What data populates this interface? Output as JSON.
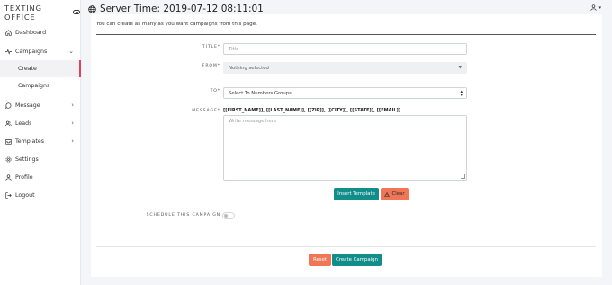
{
  "app": {
    "brand": "TEXTING OFFICE"
  },
  "header": {
    "server_time": "Server Time: 2019-07-12 08:11:01",
    "user_caret": "▾"
  },
  "sidebar": {
    "items": [
      {
        "label": "Dashboard",
        "icon": "home-icon"
      },
      {
        "label": "Campaigns",
        "icon": "activity-icon",
        "chevron": "⌄"
      },
      {
        "label": "Create",
        "active": true
      },
      {
        "label": "Campaigns"
      },
      {
        "label": "Message",
        "icon": "message-icon",
        "chevron": "›"
      },
      {
        "label": "Leads",
        "icon": "users-icon",
        "chevron": "›"
      },
      {
        "label": "Templates",
        "icon": "inbox-icon",
        "chevron": "›"
      },
      {
        "label": "Settings",
        "icon": "gear-icon"
      },
      {
        "label": "Profile",
        "icon": "user-icon"
      },
      {
        "label": "Logout",
        "icon": "logout-icon"
      }
    ]
  },
  "page": {
    "intro": "You can create as many as you want campaigns from this page."
  },
  "form": {
    "title_label": "TITLE*",
    "title_placeholder": "Title",
    "from_label": "FROM*",
    "from_value": "Nothing selected",
    "to_label": "TO*",
    "to_value": "Select To Numbers Groups",
    "message_label": "MESSAGE*",
    "tokens": "[[FIRST_NAME]], [[LAST_NAME]], [[ZIP]], [[CITY]], [[STATE]], [[EMAIL]]",
    "message_placeholder": "Write message here",
    "insert_template_label": "Insert Template",
    "clear_label": "Clear",
    "schedule_label": "SCHEDULE THIS CAMPAIGN",
    "schedule_on": false,
    "reset_label": "Reset",
    "create_label": "Create Campaign"
  },
  "colors": {
    "teal": "#118d8a",
    "orange": "#f07656",
    "active_marker": "#e83e5c"
  }
}
